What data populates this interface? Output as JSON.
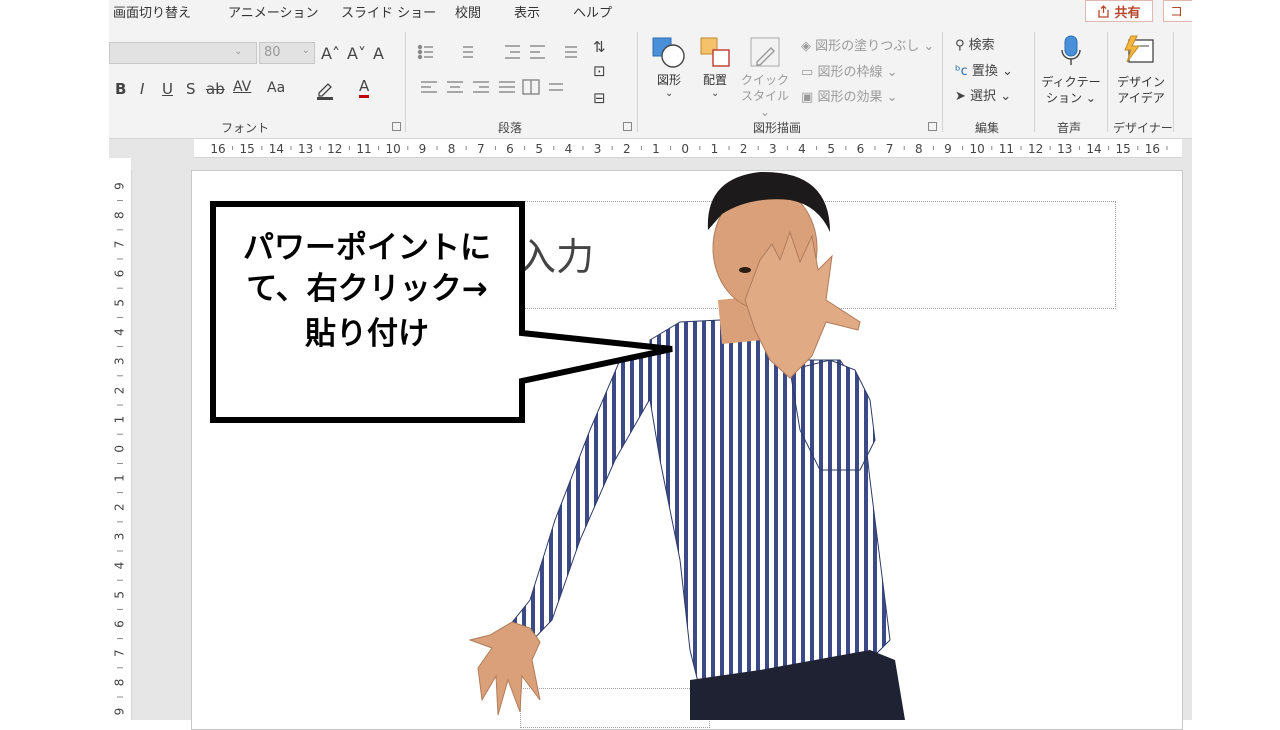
{
  "ribbon": {
    "tabs": [
      "画面切り替え",
      "アニメーション",
      "スライド ショー",
      "校閲",
      "表示",
      "ヘルプ"
    ],
    "share_label": "共有",
    "comment_label": "コ",
    "font": {
      "size_value": "80",
      "grow": "A˄",
      "shrink": "A˅",
      "clear": "A",
      "bold": "B",
      "italic": "I",
      "underline": "U",
      "shadow": "S",
      "strike": "ab",
      "spacing": "AV",
      "case": "Aa",
      "color": "A",
      "group_label": "フォント"
    },
    "paragraph": {
      "group_label": "段落"
    },
    "drawing": {
      "shape_label": "図形",
      "arrange_label": "配置",
      "quick_style_label_1": "クイック",
      "quick_style_label_2": "スタイル",
      "fill_label": "図形の塗りつぶし",
      "outline_label": "図形の枠線",
      "effects_label": "図形の効果",
      "group_label": "図形描画"
    },
    "editing": {
      "find_label": "検索",
      "replace_label": "置換",
      "select_label": "選択",
      "group_label": "編集"
    },
    "voice": {
      "dictate_label_1": "ディクテー",
      "dictate_label_2": "ション",
      "group_label": "音声"
    },
    "designer": {
      "ideas_label_1": "デザイン",
      "ideas_label_2": "アイデア",
      "group_label": "デザイナー"
    }
  },
  "ruler": {
    "horizontal_labels": [
      "16",
      "15",
      "14",
      "13",
      "12",
      "11",
      "10",
      "9",
      "8",
      "7",
      "6",
      "5",
      "4",
      "3",
      "2",
      "1",
      "0",
      "1",
      "2",
      "3",
      "4",
      "5",
      "6",
      "7",
      "8",
      "9",
      "10",
      "11",
      "12",
      "13",
      "14",
      "15",
      "16"
    ],
    "vertical_labels": [
      "9",
      "8",
      "7",
      "6",
      "5",
      "4",
      "3",
      "2",
      "1",
      "0",
      "1",
      "2",
      "3",
      "4",
      "5",
      "6",
      "7",
      "8",
      "9"
    ]
  },
  "slide": {
    "title_text": "入力"
  },
  "callout": {
    "lines": [
      "パワーポイントに",
      "て、右クリック→",
      "貼り付け"
    ]
  },
  "colors": {
    "accent": "#b7472a",
    "ribbon_bg": "#f3f3f3",
    "shirt_stripe": "#3b4a86"
  }
}
